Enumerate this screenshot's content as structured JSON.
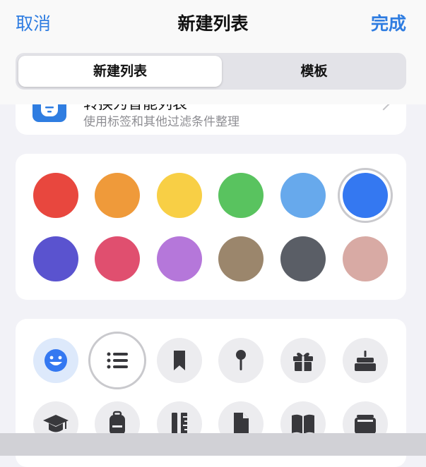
{
  "nav": {
    "cancel": "取消",
    "title": "新建列表",
    "done": "完成"
  },
  "segment": {
    "active": "新建列表",
    "inactive": "模板"
  },
  "smart_list": {
    "title": "转换为智能列表",
    "subtitle": "使用标签和其他过滤条件整理",
    "icon": "filter-list-icon"
  },
  "colors": [
    {
      "name": "red",
      "hex": "#e8473e"
    },
    {
      "name": "orange",
      "hex": "#ef9a3a"
    },
    {
      "name": "yellow",
      "hex": "#f8cf45"
    },
    {
      "name": "green",
      "hex": "#59c35f"
    },
    {
      "name": "light-blue",
      "hex": "#67a9ec"
    },
    {
      "name": "blue",
      "hex": "#3478f1",
      "selected": true
    },
    {
      "name": "indigo",
      "hex": "#5a53cf"
    },
    {
      "name": "pink",
      "hex": "#e04f6f"
    },
    {
      "name": "purple",
      "hex": "#b577da"
    },
    {
      "name": "brown",
      "hex": "#9b866c"
    },
    {
      "name": "gray",
      "hex": "#5a5e66"
    },
    {
      "name": "rose",
      "hex": "#d8aaa4"
    }
  ],
  "icons": [
    {
      "name": "smiley-icon",
      "selected_tint": true
    },
    {
      "name": "list-bullet-icon",
      "selected": true
    },
    {
      "name": "bookmark-icon"
    },
    {
      "name": "pin-icon"
    },
    {
      "name": "gift-icon"
    },
    {
      "name": "birthday-cake-icon"
    },
    {
      "name": "graduation-cap-icon"
    },
    {
      "name": "backpack-icon"
    },
    {
      "name": "ruler-icon"
    },
    {
      "name": "document-icon"
    },
    {
      "name": "book-icon"
    },
    {
      "name": "wallet-icon"
    }
  ],
  "theme": {
    "accent": "#2f7de1",
    "icon_fg": "#38383c"
  }
}
